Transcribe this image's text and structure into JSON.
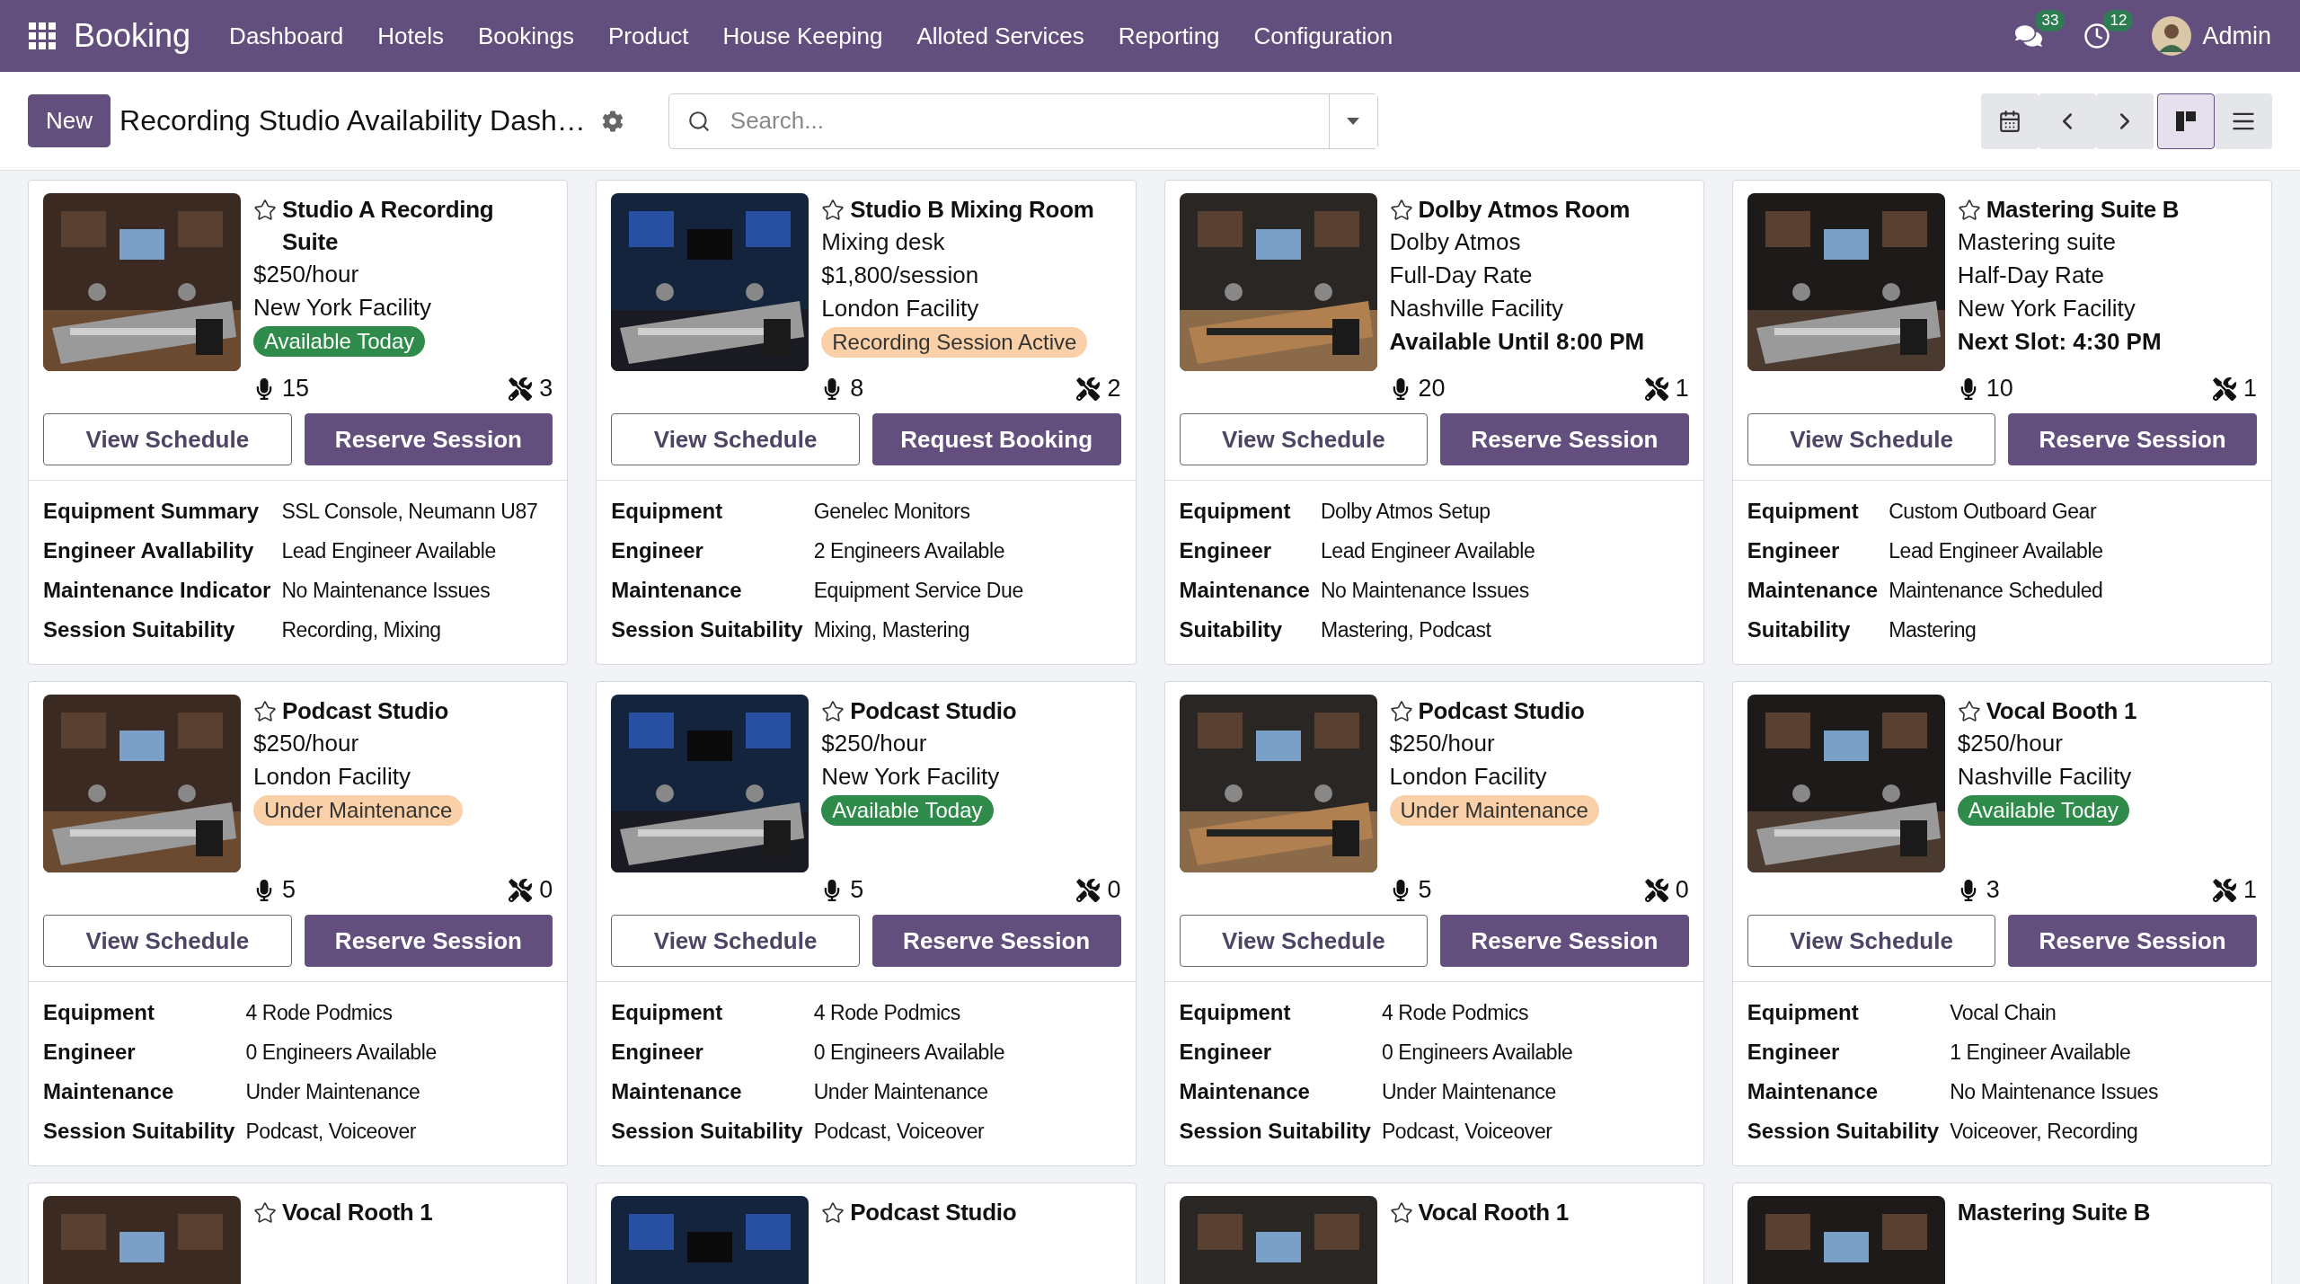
{
  "navbar": {
    "app_name": "Booking",
    "menu": [
      "Dashboard",
      "Hotels",
      "Bookings",
      "Product",
      "House Keeping",
      "Alloted Services",
      "Reporting",
      "Configuration"
    ],
    "messages_count": "33",
    "activities_count": "12",
    "user": "Admin"
  },
  "control_bar": {
    "new_label": "New",
    "title": "Recording Studio Availability Dash…",
    "search": {
      "placeholder": "Search..."
    },
    "views": [
      {
        "kind": "kanban",
        "selected": true
      },
      {
        "kind": "list",
        "selected": false
      }
    ]
  },
  "cards": [
    {
      "name": "Studio A Recording Suite",
      "favorite": false,
      "lines": [
        {
          "kind": "text",
          "text": "$250/hour"
        },
        {
          "kind": "text",
          "text": "New York Facility"
        },
        {
          "kind": "badge",
          "text": "Available Today",
          "color": "#2e8b4a"
        }
      ],
      "mics": "15",
      "tools": "3",
      "buttons": [
        {
          "kind": "outline",
          "label": "View Schedule"
        },
        {
          "kind": "primary",
          "label": "Reserve Session"
        }
      ],
      "details": [
        {
          "label": "Equipment Summary",
          "value": "SSL Console, Neumann U87"
        },
        {
          "label": "Engineer Avallability",
          "value": "Lead Engineer Available"
        },
        {
          "label": "Maintenance Indicator",
          "value": "No Maintenance Issues"
        },
        {
          "label": "Session Suitability",
          "value": "Recording, Mixing"
        }
      ]
    },
    {
      "name": "Studio B Mixing Room",
      "favorite": false,
      "lines": [
        {
          "kind": "text",
          "text": "Mixing desk"
        },
        {
          "kind": "text",
          "text": "$1,800/session"
        },
        {
          "kind": "text",
          "text": "London Facility"
        },
        {
          "kind": "badge",
          "text": "Recording Session Active",
          "color": "#f9d0a8"
        }
      ],
      "mics": "8",
      "tools": "2",
      "buttons": [
        {
          "kind": "outline",
          "label": "View Schedule"
        },
        {
          "kind": "primary",
          "label": "Request Booking"
        }
      ],
      "details": [
        {
          "label": "Equipment",
          "value": "Genelec Monitors"
        },
        {
          "label": "Engineer",
          "value": "2 Engineers Available"
        },
        {
          "label": "Maintenance",
          "value": "Equipment Service Due"
        },
        {
          "label": "Session Suitability",
          "value": "Mixing, Mastering"
        }
      ]
    },
    {
      "name": "Dolby Atmos Room",
      "favorite": false,
      "lines": [
        {
          "kind": "text",
          "text": "Dolby Atmos"
        },
        {
          "kind": "text",
          "text": "Full-Day Rate"
        },
        {
          "kind": "text",
          "text": "Nashville Facility"
        },
        {
          "kind": "strong",
          "text": "Available Until 8:00 PM"
        }
      ],
      "mics": "20",
      "tools": "1",
      "buttons": [
        {
          "kind": "outline",
          "label": "View Schedule"
        },
        {
          "kind": "primary",
          "label": "Reserve Session"
        }
      ],
      "details": [
        {
          "label": "Equipment",
          "value": "Dolby Atmos Setup"
        },
        {
          "label": "Engineer",
          "value": "Lead Engineer Available"
        },
        {
          "label": "Maintenance",
          "value": "No Maintenance Issues"
        },
        {
          "label": "Suitability",
          "value": "Mastering, Podcast"
        }
      ]
    },
    {
      "name": "Mastering Suite B",
      "favorite": false,
      "lines": [
        {
          "kind": "text",
          "text": "Mastering suite"
        },
        {
          "kind": "text",
          "text": "Half-Day Rate"
        },
        {
          "kind": "text",
          "text": "New York Facility"
        },
        {
          "kind": "strong",
          "text": "Next Slot: 4:30 PM"
        }
      ],
      "mics": "10",
      "tools": "1",
      "buttons": [
        {
          "kind": "outline",
          "label": "View Schedule"
        },
        {
          "kind": "primary",
          "label": "Reserve Session"
        }
      ],
      "details": [
        {
          "label": "Equipment",
          "value": "Custom Outboard Gear"
        },
        {
          "label": "Engineer",
          "value": "Lead Engineer Available"
        },
        {
          "label": "Maintenance",
          "value": "Maintenance Scheduled"
        },
        {
          "label": "Suitability",
          "value": "Mastering"
        }
      ]
    },
    {
      "name": "Podcast Studio",
      "favorite": false,
      "lines": [
        {
          "kind": "text",
          "text": "$250/hour"
        },
        {
          "kind": "text",
          "text": "London Facility"
        },
        {
          "kind": "badge",
          "text": "Under Maintenance",
          "color": "#f9d0a8"
        }
      ],
      "mics": "5",
      "tools": "0",
      "buttons": [
        {
          "kind": "outline",
          "label": "View Schedule"
        },
        {
          "kind": "primary",
          "label": "Reserve Session"
        }
      ],
      "details": [
        {
          "label": "Equipment",
          "value": "4 Rode Podmics"
        },
        {
          "label": "Engineer",
          "value": "0 Engineers Available"
        },
        {
          "label": "Maintenance",
          "value": "Under Maintenance"
        },
        {
          "label": "Session Suitability",
          "value": "Podcast, Voiceover"
        }
      ]
    },
    {
      "name": "Podcast Studio",
      "favorite": false,
      "lines": [
        {
          "kind": "text",
          "text": "$250/hour"
        },
        {
          "kind": "text",
          "text": "New York Facility"
        },
        {
          "kind": "badge",
          "text": "Available Today",
          "color": "#2e8b4a"
        }
      ],
      "mics": "5",
      "tools": "0",
      "buttons": [
        {
          "kind": "outline",
          "label": "View Schedule"
        },
        {
          "kind": "primary",
          "label": "Reserve Session"
        }
      ],
      "details": [
        {
          "label": "Equipment",
          "value": "4 Rode Podmics"
        },
        {
          "label": "Engineer",
          "value": "0 Engineers Available"
        },
        {
          "label": "Maintenance",
          "value": "Under Maintenance"
        },
        {
          "label": "Session Suitability",
          "value": "Podcast, Voiceover"
        }
      ]
    },
    {
      "name": "Podcast Studio",
      "favorite": false,
      "lines": [
        {
          "kind": "text",
          "text": "$250/hour"
        },
        {
          "kind": "text",
          "text": "London Facility"
        },
        {
          "kind": "badge",
          "text": "Under Maintenance",
          "color": "#f9d0a8"
        }
      ],
      "mics": "5",
      "tools": "0",
      "buttons": [
        {
          "kind": "outline",
          "label": "View Schedule"
        },
        {
          "kind": "primary",
          "label": "Reserve Session"
        }
      ],
      "details": [
        {
          "label": "Equipment",
          "value": "4 Rode Podmics"
        },
        {
          "label": "Engineer",
          "value": "0 Engineers Available"
        },
        {
          "label": "Maintenance",
          "value": "Under Maintenance"
        },
        {
          "label": "Session Suitability",
          "value": "Podcast, Voiceover"
        }
      ]
    },
    {
      "name": "Vocal Booth 1",
      "favorite": false,
      "lines": [
        {
          "kind": "text",
          "text": "$250/hour"
        },
        {
          "kind": "text",
          "text": "Nashville Facility"
        },
        {
          "kind": "badge",
          "text": "Available Today",
          "color": "#2e8b4a"
        }
      ],
      "mics": "3",
      "tools": "1",
      "buttons": [
        {
          "kind": "outline",
          "label": "View Schedule"
        },
        {
          "kind": "primary",
          "label": "Reserve Session"
        }
      ],
      "details": [
        {
          "label": "Equipment",
          "value": "Vocal Chain"
        },
        {
          "label": "Engineer",
          "value": "1 Engineer Available"
        },
        {
          "label": "Maintenance",
          "value": "No Maintenance Issues"
        },
        {
          "label": "Session Suitability",
          "value": "Voiceover, Recording"
        }
      ]
    },
    {
      "name": "Vocal Rooth 1",
      "favorite": false
    },
    {
      "name": "Podcast Studio",
      "favorite": false
    },
    {
      "name": "Vocal Rooth 1",
      "favorite": false
    },
    {
      "name": "Mastering Suite B"
    }
  ]
}
